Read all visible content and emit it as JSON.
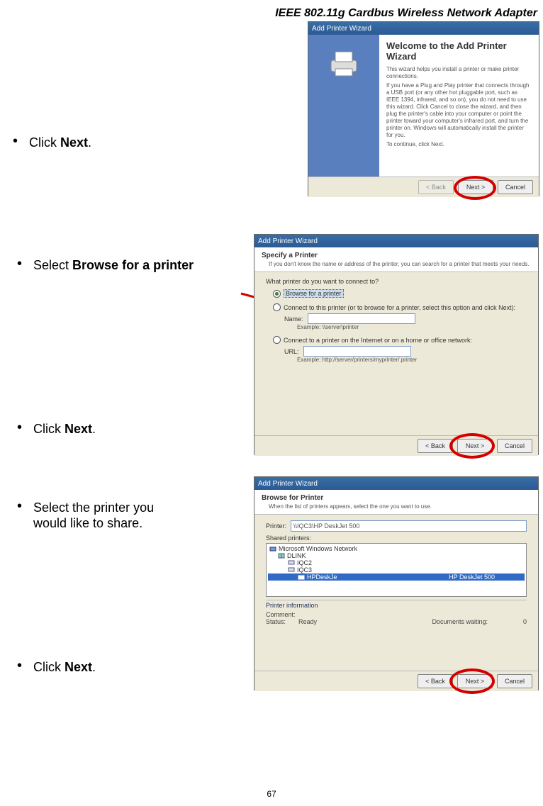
{
  "header": "IEEE 802.11g Cardbus Wireless Network Adapter",
  "bullets": {
    "b1_pre": "Click ",
    "b1_bold": "Next",
    "b1_post": ".",
    "b2_pre": "Select ",
    "b2_bold": "Browse for a printer",
    "b3_pre": "Click ",
    "b3_bold": "Next",
    "b3_post": ".",
    "b4_line1": "Select the printer you",
    "b4_line2": "would like to share.",
    "b5_pre": "Click ",
    "b5_bold": "Next",
    "b5_post": "."
  },
  "window1": {
    "title": "Add Printer Wizard",
    "heading": "Welcome to the Add Printer Wizard",
    "para1": "This wizard helps you install a printer or make printer connections.",
    "para2": "If you have a Plug and Play printer that connects through a USB port (or any other hot pluggable port, such as IEEE 1394, infrared, and so on), you do not need to use this wizard. Click Cancel to close the wizard, and then plug the printer's cable into your computer or point the printer toward your computer's infrared port, and turn the printer on. Windows will automatically install the printer for you.",
    "para3": "To continue, click Next.",
    "btn_back": "< Back",
    "btn_next": "Next >",
    "btn_cancel": "Cancel"
  },
  "window2": {
    "title": "Add Printer Wizard",
    "hdr_bold": "Specify a Printer",
    "hdr_sub": "If you don't know the name or address of the printer, you can search for a printer that meets your needs.",
    "question": "What printer do you want to connect to?",
    "opt1": "Browse for a printer",
    "opt2": "Connect to this printer (or to browse for a printer, select this option and click Next):",
    "name_lbl": "Name:",
    "name_ex": "Example: \\\\server\\printer",
    "opt3": "Connect to a printer on the Internet or on a home or office network:",
    "url_lbl": "URL:",
    "url_ex": "Example: http://server/printers/myprinter/.printer",
    "btn_back": "< Back",
    "btn_next": "Next >",
    "btn_cancel": "Cancel"
  },
  "window3": {
    "title": "Add Printer Wizard",
    "hdr_bold": "Browse for Printer",
    "hdr_sub": "When the list of printers appears, select the one you want to use.",
    "printer_lbl": "Printer:",
    "printer_val": "\\\\IQC3\\HP DeskJet 500",
    "shared_lbl": "Shared printers:",
    "tree_root": "Microsoft Windows Network",
    "tree_grp": "DLINK",
    "tree_n1": "IQC2",
    "tree_n2": "IQC3",
    "tree_sel_left": "HPDeskJe",
    "tree_sel_right": "HP DeskJet 500",
    "info_title": "Printer information",
    "info_comment_lbl": "Comment:",
    "info_status_lbl": "Status:",
    "info_status_val": "Ready",
    "info_docs_lbl": "Documents waiting:",
    "info_docs_val": "0",
    "btn_back": "< Back",
    "btn_next": "Next >",
    "btn_cancel": "Cancel"
  },
  "page_number": "67"
}
